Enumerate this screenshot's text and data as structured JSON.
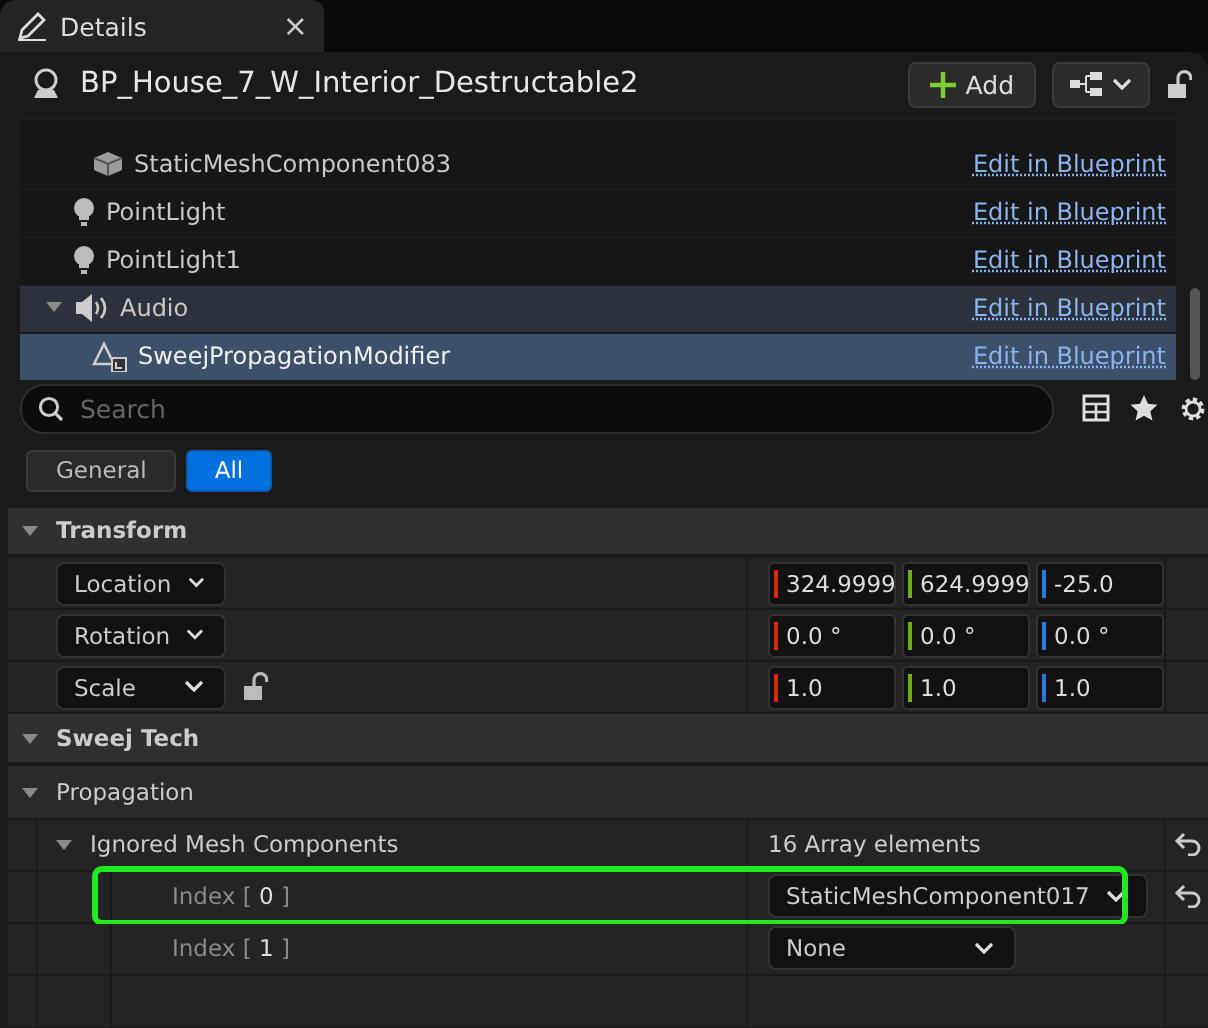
{
  "tab": {
    "label": "Details",
    "close": "×"
  },
  "header": {
    "title": "BP_House_7_W_Interior_Destructable2",
    "add_button": "Add",
    "locked": false
  },
  "components": [
    {
      "children": [
        {
          "label": "StaticMeshComponent083",
          "kind": "mesh",
          "selected": false,
          "hovered": false,
          "link": "Edit in Blueprint"
        }
      ]
    },
    {
      "label": "PointLight",
      "kind": "light",
      "selected": false,
      "hovered": false,
      "link": "Edit in Blueprint"
    },
    {
      "label": "PointLight1",
      "kind": "light",
      "selected": false,
      "hovered": false,
      "link": "Edit in Blueprint"
    },
    {
      "label": "Audio",
      "kind": "audio",
      "selected": false,
      "hovered": true,
      "expanded": true,
      "link": "Edit in Blueprint",
      "children": [
        {
          "label": "SweejPropagationModifier",
          "kind": "modifier",
          "selected": true,
          "link": "Edit in Blueprint"
        }
      ]
    }
  ],
  "search": {
    "placeholder": "Search"
  },
  "filters": [
    {
      "label": "General",
      "selected": false
    },
    {
      "label": "All",
      "selected": true
    }
  ],
  "categories": [
    {
      "title": "Transform",
      "expanded": true,
      "rows": [
        {
          "kind": "vector",
          "label": "Location",
          "lock": false,
          "values": [
            "324.9999",
            "624.9999",
            "-25.0"
          ]
        },
        {
          "kind": "vector",
          "label": "Rotation",
          "lock": false,
          "values": [
            "0.0 °",
            "0.0 °",
            "0.0 °"
          ]
        },
        {
          "kind": "vector",
          "label": "Scale",
          "lock": true,
          "locked": false,
          "values": [
            "1.0",
            "1.0",
            "1.0"
          ]
        }
      ]
    },
    {
      "title": "Sweej Tech",
      "expanded": true,
      "subcategories": [
        {
          "title": "Propagation",
          "expanded": true,
          "arrays": [
            {
              "label": "Ignored Mesh Components",
              "expanded": true,
              "summary": "16 Array elements",
              "resettable": true,
              "elements": [
                {
                  "label": "Index [ **0** ]",
                  "value": "StaticMeshComponent017",
                  "highlighted": true,
                  "resettable": true
                },
                {
                  "label": "Index [ **1** ]",
                  "value": "None",
                  "highlighted": false,
                  "resettable": false
                }
              ]
            }
          ]
        }
      ]
    }
  ]
}
